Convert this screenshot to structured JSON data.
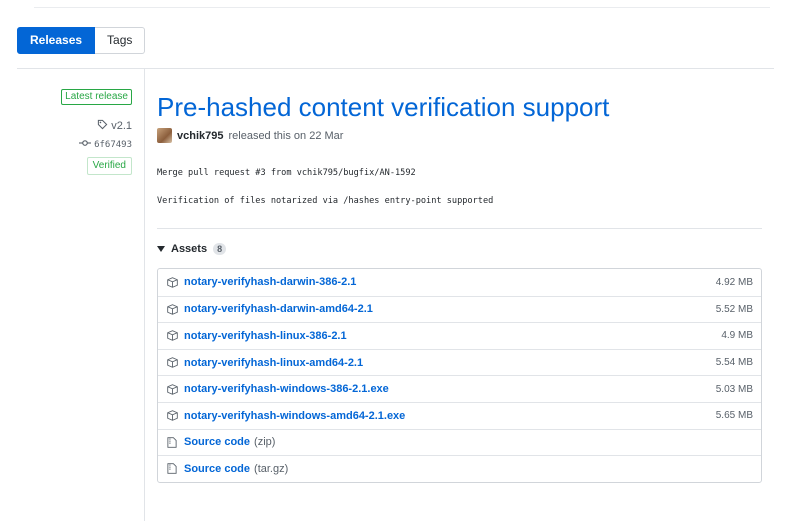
{
  "tabs": {
    "releases": "Releases",
    "tags": "Tags"
  },
  "release": {
    "latest_label": "Latest release",
    "tag": "v2.1",
    "commit": "6f67493",
    "verified": "Verified",
    "title": "Pre-hashed content verification support",
    "author": "vchik795",
    "released_text": "released this on 22 Mar",
    "body_lines": [
      "Merge pull request #3 from vchik795/bugfix/AN-1592",
      "Verification of files notarized via /hashes entry-point supported"
    ]
  },
  "assets": {
    "label": "Assets",
    "count": "8",
    "files": [
      {
        "name": "notary-verifyhash-darwin-386-2.1",
        "size": "4.92 MB"
      },
      {
        "name": "notary-verifyhash-darwin-amd64-2.1",
        "size": "5.52 MB"
      },
      {
        "name": "notary-verifyhash-linux-386-2.1",
        "size": "4.9 MB"
      },
      {
        "name": "notary-verifyhash-linux-amd64-2.1",
        "size": "5.54 MB"
      },
      {
        "name": "notary-verifyhash-windows-386-2.1.exe",
        "size": "5.03 MB"
      },
      {
        "name": "notary-verifyhash-windows-amd64-2.1.exe",
        "size": "5.65 MB"
      }
    ],
    "sources": [
      {
        "name": "Source code",
        "format": "(zip)"
      },
      {
        "name": "Source code",
        "format": "(tar.gz)"
      }
    ]
  },
  "icons": {
    "tag": "tag-icon",
    "commit": "commit-icon",
    "package": "package-icon",
    "zip": "file-zip-icon",
    "caret": "caret-down-icon"
  },
  "colors": {
    "accent": "#0366d6",
    "success": "#28a745",
    "muted": "#586069"
  }
}
